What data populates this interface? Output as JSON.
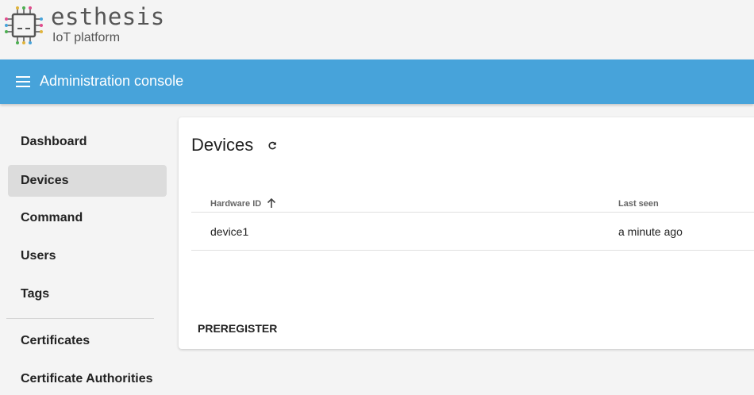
{
  "brand": {
    "name": "esthesis",
    "subtitle": "IoT platform"
  },
  "topbar": {
    "title": "Administration console",
    "menu_icon": "hamburger-menu-icon"
  },
  "sidebar": {
    "items": [
      {
        "label": "Dashboard",
        "active": false
      },
      {
        "label": "Devices",
        "active": true
      },
      {
        "label": "Command",
        "active": false
      },
      {
        "label": "Users",
        "active": false
      },
      {
        "label": "Tags",
        "active": false
      },
      {
        "label": "Certificates",
        "active": false
      },
      {
        "label": "Certificate Authorities",
        "active": false
      }
    ]
  },
  "main": {
    "title": "Devices",
    "refresh_icon": "refresh-icon",
    "table": {
      "columns": [
        {
          "label": "Hardware ID",
          "sort": "ascending"
        },
        {
          "label": "Last seen"
        }
      ],
      "rows": [
        {
          "hardware_id": "device1",
          "last_seen": "a minute ago"
        }
      ]
    },
    "preregister_label": "PREREGISTER"
  },
  "colors": {
    "topbar": "#47a3da",
    "page_background": "#f4f4f4",
    "active_nav": "#dcdcdc"
  }
}
